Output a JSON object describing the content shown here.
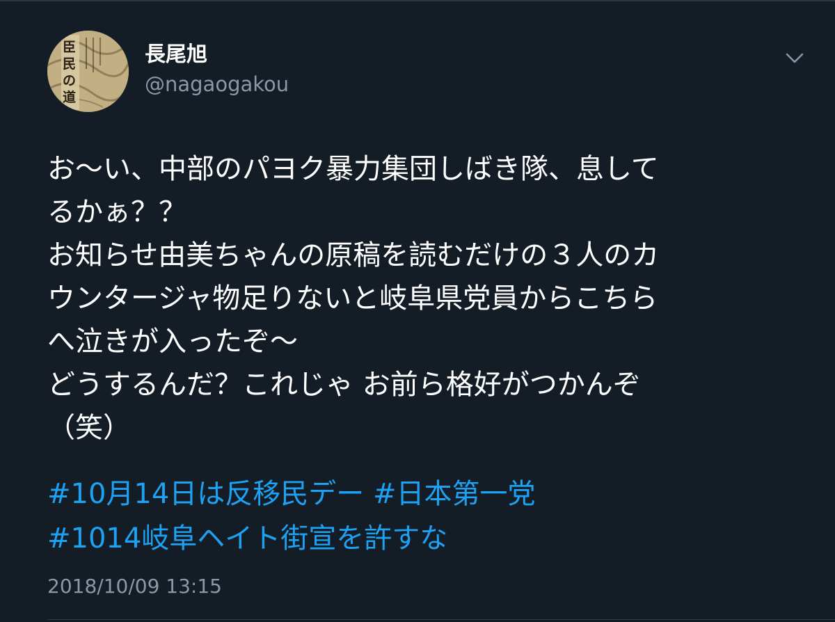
{
  "user": {
    "display_name": "長尾旭",
    "handle": "@nagaogakou",
    "avatar_icon": "book-cover-avatar",
    "avatar_text": "臣民の道"
  },
  "menu": {
    "icon": "chevron-down-icon"
  },
  "tweet": {
    "lines": [
      "お〜い、中部のパヨク暴力集団しばき隊、息して",
      "るかぁ？？",
      "お知らせ由美ちゃんの原稿を読むだけの３人のカ",
      "ウンタージャ物足りないと岐阜県党員からこちら",
      "へ泣きが入ったぞ〜",
      "どうするんだ？これじゃ お前ら格好がつかんぞ",
      "（笑）"
    ],
    "hashtags": [
      "#10月14日は反移民デー",
      "#日本第一党",
      "#1014岐阜ヘイト街宣を許すな"
    ],
    "timestamp": "2018/10/09 13:15"
  },
  "colors": {
    "background": "#141d26",
    "text": "#ffffff",
    "secondary": "#8b98a5",
    "link": "#1da1f2"
  }
}
